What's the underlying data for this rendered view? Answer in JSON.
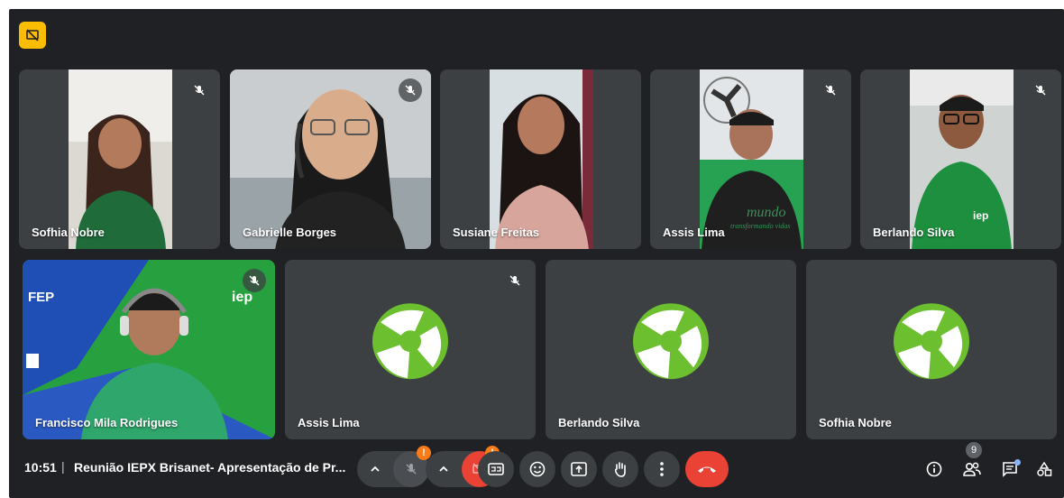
{
  "participants_row1": [
    {
      "name": "Sofhia Nobre",
      "muted": true
    },
    {
      "name": "Gabrielle Borges",
      "muted": true
    },
    {
      "name": "Susiane Freitas",
      "muted": false
    },
    {
      "name": "Assis Lima",
      "muted": true
    },
    {
      "name": "Berlando Silva",
      "muted": true
    }
  ],
  "participants_row2": [
    {
      "name": "Francisco Mila Rodrigues",
      "muted": true
    },
    {
      "name": "Assis Lima",
      "muted": true
    },
    {
      "name": "Berlando Silva",
      "muted": false
    },
    {
      "name": "Sofhia Nobre",
      "muted": false
    }
  ],
  "video_text": {
    "tshirt_line1": "mundo",
    "tshirt_line2": "transformando vidas",
    "brand_shirt": "iep",
    "bg_brand_left": "FEP",
    "bg_brand_right": "iep"
  },
  "bottom_bar": {
    "time": "10:51",
    "separator": "|",
    "meeting_title": "Reunião IEPX Brisanet- Apresentação de Pr...",
    "mic_warning": "!",
    "cam_warning": "!",
    "participant_count": "9"
  },
  "icons": {
    "top_left": "no-presenting-icon",
    "mute": "mic-off-icon",
    "controls": [
      "chevron-up-icon",
      "mic-icon",
      "chevron-up-icon",
      "camera-off-icon",
      "captions-icon",
      "emoji-icon",
      "present-icon",
      "hand-icon",
      "more-icon",
      "hangup-icon"
    ],
    "right": [
      "info-icon",
      "people-icon",
      "chat-icon",
      "activities-icon"
    ]
  },
  "colors": {
    "background": "#202124",
    "tile": "#3c4043",
    "accent_yellow": "#fbbc04",
    "hangup_red": "#ea4335",
    "warning_orange": "#fa7b17",
    "brand_green": "#1e8f3e"
  }
}
